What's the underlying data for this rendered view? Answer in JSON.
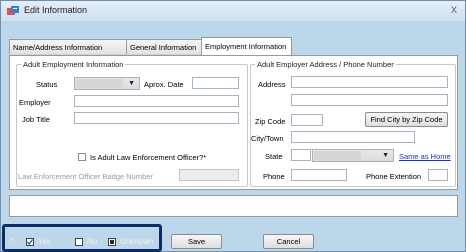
{
  "window": {
    "title": "Edit Information",
    "close_label": "X"
  },
  "tabs": [
    {
      "label": "Name/Address Information"
    },
    {
      "label": "General Information"
    },
    {
      "label": "Employment Information"
    }
  ],
  "employment": {
    "group_label": "Adult Employment Information",
    "status_label": "Status",
    "aprox_date_label": "Aprox. Date",
    "employer_label": "Employer",
    "job_title_label": "Job Title",
    "officer_check_label": "Is Adult Law Enforcement Officer?*",
    "badge_label": "Law Enforcement Officer Badge Number"
  },
  "employer_address": {
    "group_label": "Adult Employer Address / Phone Number",
    "address_label": "Address",
    "zip_label": "Zip Code",
    "find_city_label": "Find City by Zip Code",
    "city_label": "City/Town",
    "state_label": "State",
    "same_as_home_label": "Same as Home",
    "phone_label": "Phone",
    "phone_ext_label": "Phone Extention"
  },
  "footer": {
    "asterisk": "*-",
    "legend_yes": "Yes",
    "legend_no": "No",
    "legend_unknown": "Unknown",
    "save_label": "Save",
    "cancel_label": "Cancel"
  },
  "colors": {
    "window_bg": "#bcd6ea",
    "highlight_border": "#0b2d68",
    "link": "#1a2bd8"
  }
}
